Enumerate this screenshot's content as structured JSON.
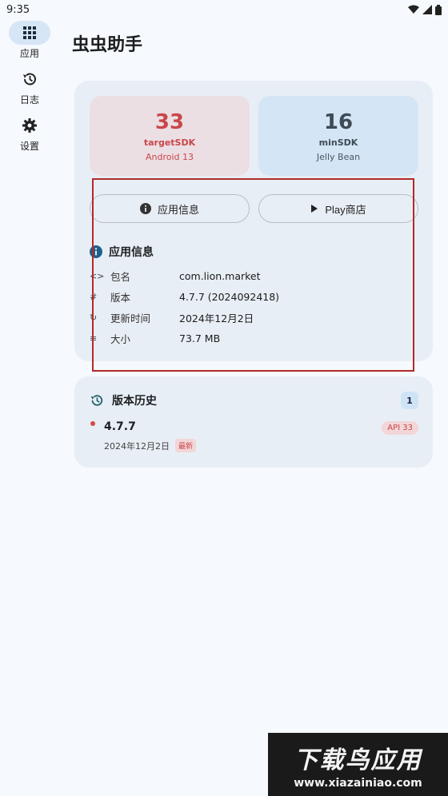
{
  "status_bar": {
    "time": "9:35"
  },
  "rail": {
    "items": [
      {
        "label": "应用",
        "icon": "grid-icon",
        "active": true
      },
      {
        "label": "日志",
        "icon": "history-icon",
        "active": false
      },
      {
        "label": "设置",
        "icon": "gear-icon",
        "active": false
      }
    ]
  },
  "app_title": "虫虫助手",
  "stats": {
    "target": {
      "value": "33",
      "label": "targetSDK",
      "sub": "Android 13"
    },
    "min": {
      "value": "16",
      "label": "minSDK",
      "sub": "Jelly Bean"
    }
  },
  "buttons": {
    "info": "应用信息",
    "play": "Play商店"
  },
  "info_section": {
    "title": "应用信息",
    "rows": [
      {
        "icon": "code-icon",
        "key": "包名",
        "value": "com.lion.market"
      },
      {
        "icon": "hash-icon",
        "key": "版本",
        "value": "4.7.7 (2024092418)"
      },
      {
        "icon": "update-icon",
        "key": "更新时间",
        "value": "2024年12月2日"
      },
      {
        "icon": "storage-icon",
        "key": "大小",
        "value": "73.7 MB"
      }
    ]
  },
  "history": {
    "title": "版本历史",
    "count": "1",
    "entries": [
      {
        "version": "4.7.7",
        "date": "2024年12月2日",
        "badge": "最新",
        "api": "API 33"
      }
    ]
  },
  "watermark": {
    "big": "下载鸟应用",
    "small": "www.xiazainiao.com"
  },
  "colors": {
    "accent_red": "#c9474a",
    "highlight_border": "#b22a28",
    "card_bg": "#e8eef5"
  }
}
